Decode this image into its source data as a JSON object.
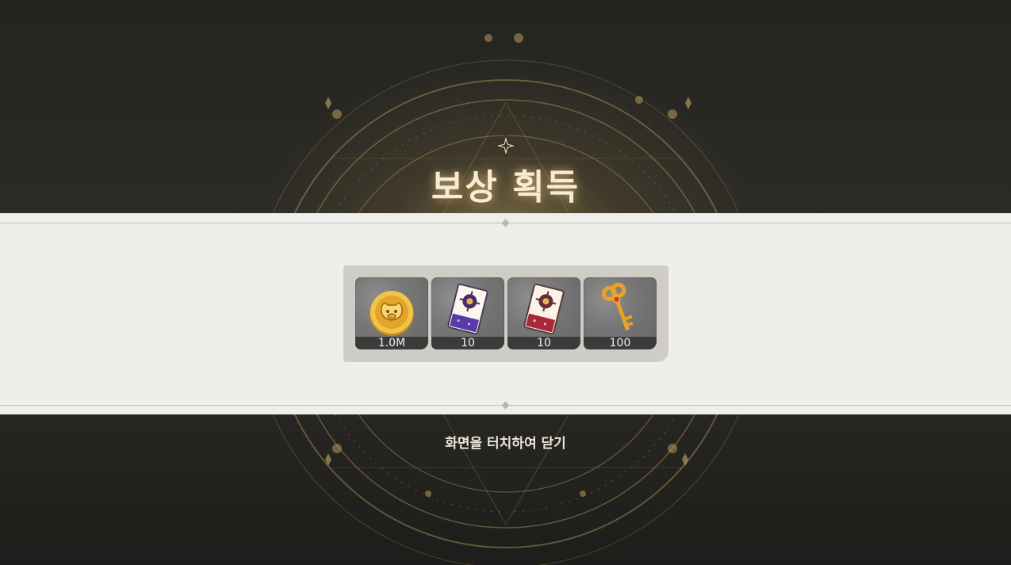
{
  "title": "보상 획득",
  "rewards": [
    {
      "icon": "gold-coin-icon",
      "count": "1.0M"
    },
    {
      "icon": "purple-card-ticket-icon",
      "count": "10"
    },
    {
      "icon": "red-card-ticket-icon",
      "count": "10"
    },
    {
      "icon": "golden-key-icon",
      "count": "100"
    }
  ],
  "close_hint": "화면을 터치하여 닫기",
  "colors": {
    "background": "#2a2925",
    "banner": "#eeeeea",
    "panel": "#cfcdc6",
    "slot": "#777777",
    "gold": "#d8b45a"
  }
}
